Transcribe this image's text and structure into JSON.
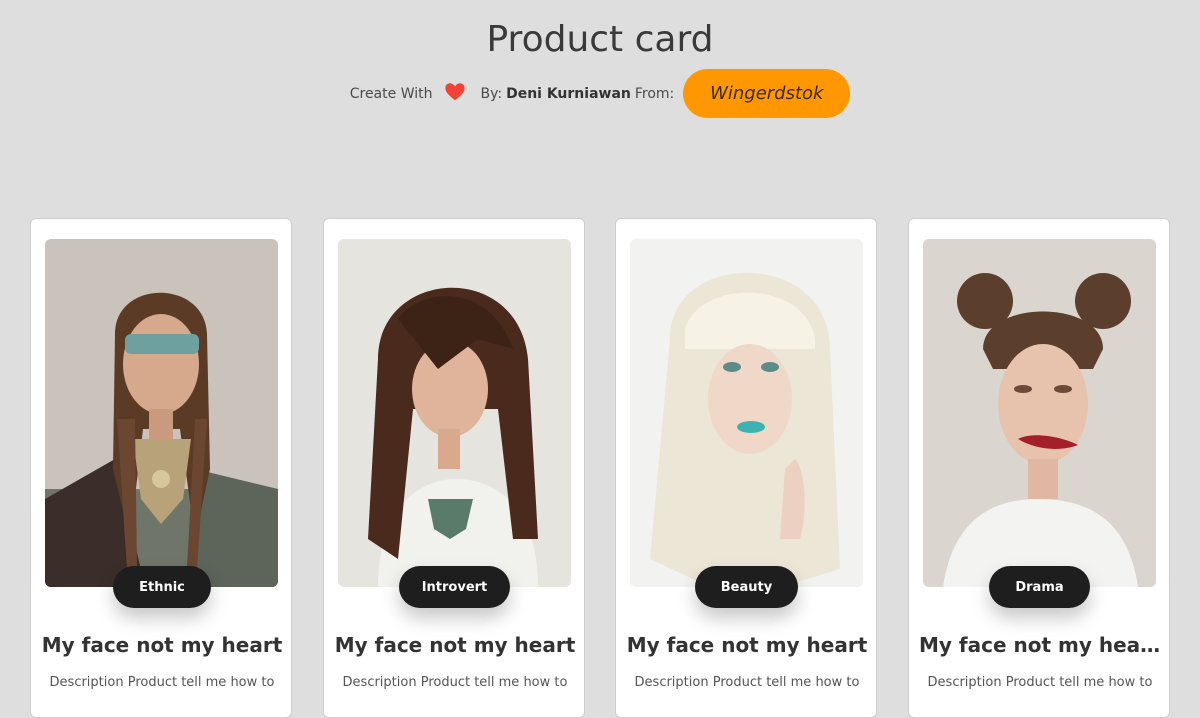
{
  "header": {
    "title": "Product card",
    "create_with": "Create With",
    "heart_icon": "heart-icon",
    "by_label": "By:",
    "author": "Deni Kurniawan",
    "from_label": "From:",
    "source_button": "Wingerdstok"
  },
  "colors": {
    "background": "#dedede",
    "accent": "#ff9800",
    "heart": "#f44336",
    "tag_bg": "#1e1e1e"
  },
  "cards": [
    {
      "tag": "Ethnic",
      "title": "My face not my heart",
      "description": "Description Product tell me how to"
    },
    {
      "tag": "Introvert",
      "title": "My face not my heart",
      "description": "Description Product tell me how to"
    },
    {
      "tag": "Beauty",
      "title": "My face not my heart",
      "description": "Description Product tell me how to"
    },
    {
      "tag": "Drama",
      "title": "My face not my heart ...",
      "description": "Description Product tell me how to"
    }
  ]
}
